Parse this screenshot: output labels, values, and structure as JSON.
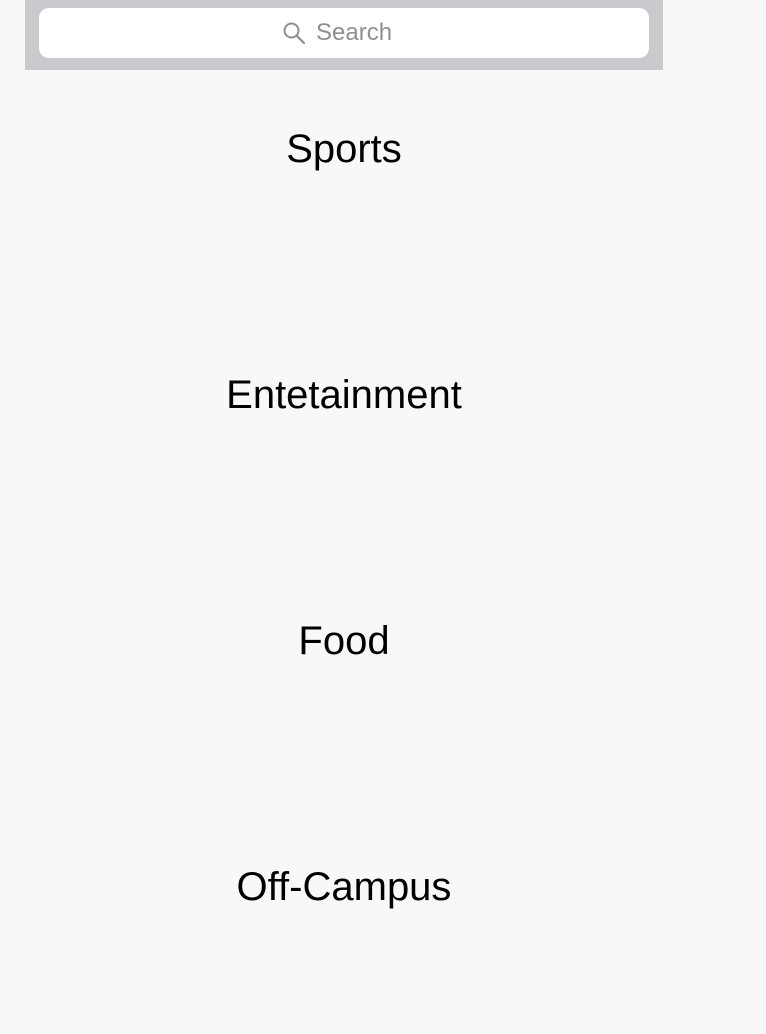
{
  "search": {
    "placeholder": "Search",
    "icon": "search-icon"
  },
  "categories": [
    {
      "label": "Sports"
    },
    {
      "label": "Entetainment"
    },
    {
      "label": "Food"
    },
    {
      "label": "Off-Campus"
    }
  ],
  "colors": {
    "background": "#f8f8f8",
    "search_bar": "#c9c9ce",
    "search_field": "#ffffff",
    "placeholder": "#8e8e93",
    "text": "#000000"
  }
}
